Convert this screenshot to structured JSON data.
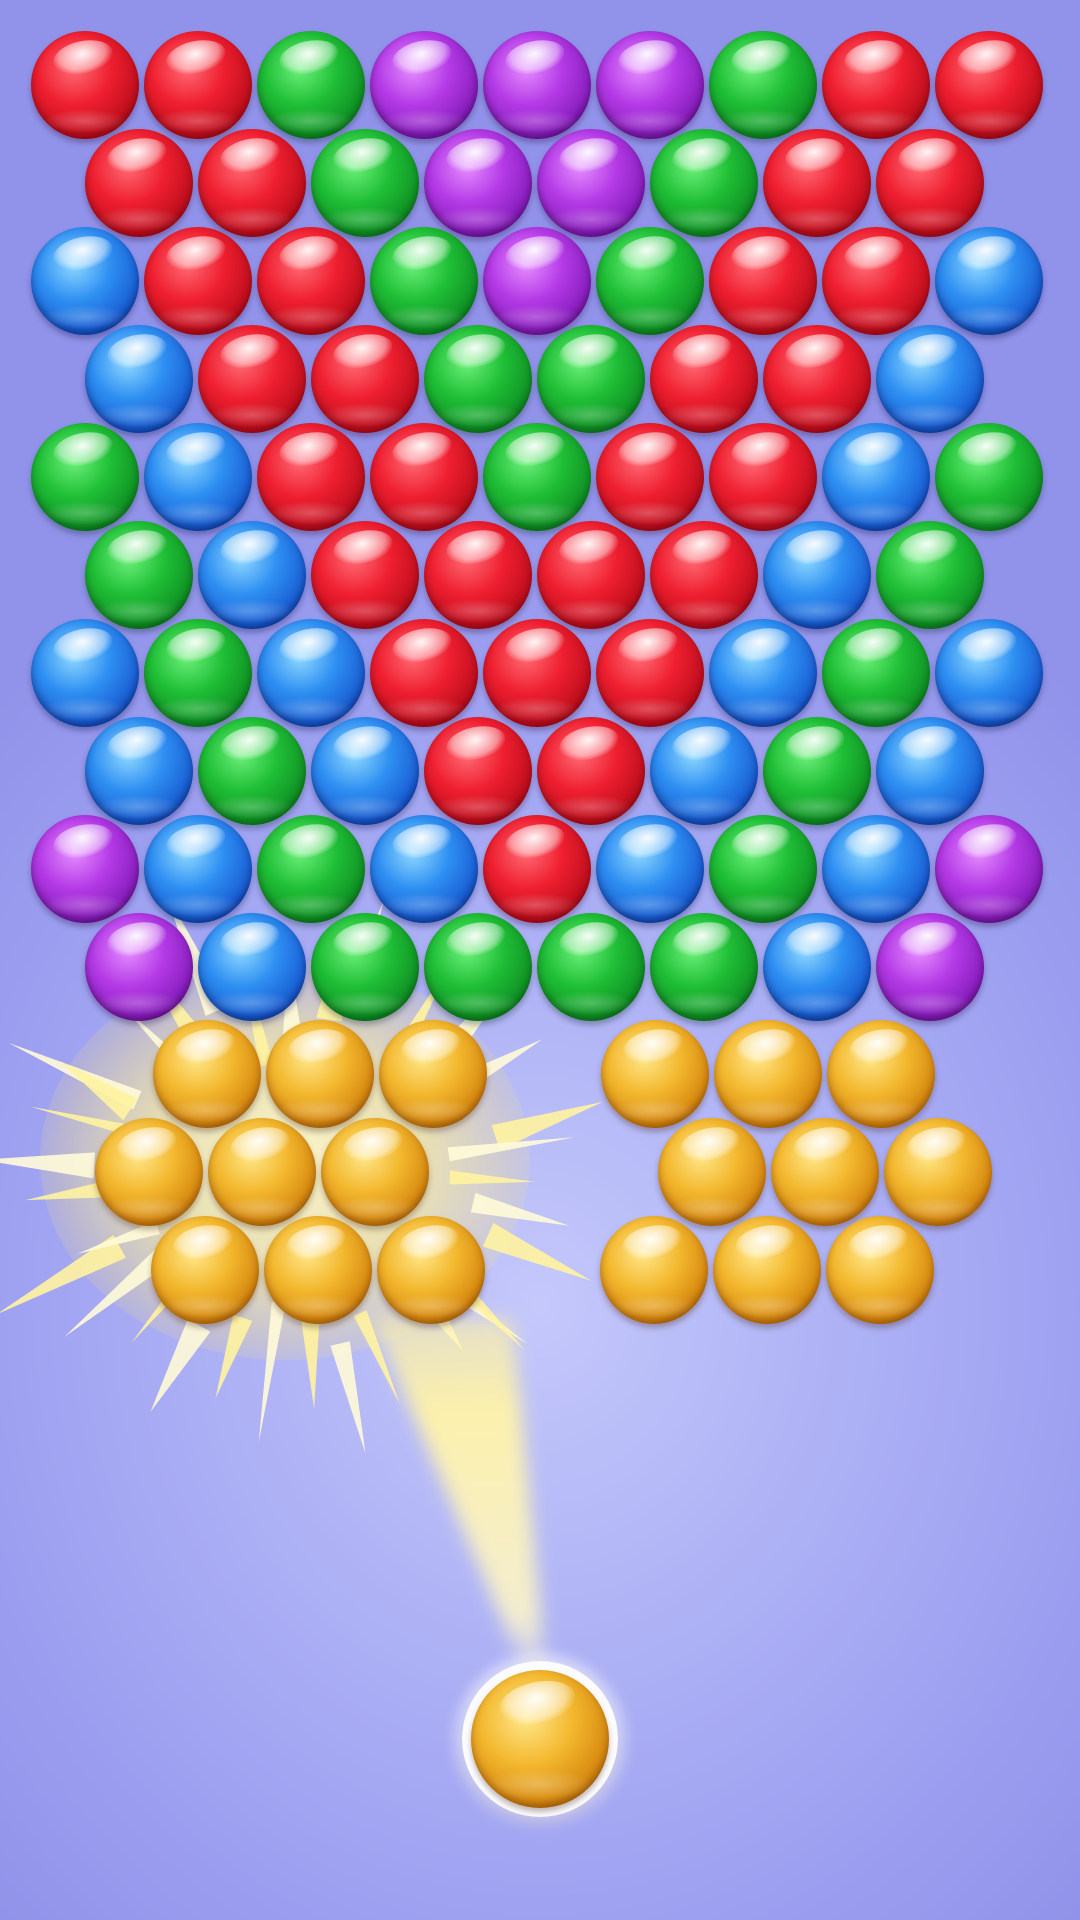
{
  "scene": "bubble-shooter",
  "colors": {
    "background": "#a7aaf3",
    "red": "#e81b2c",
    "green": "#1cb533",
    "purple": "#ac35de",
    "blue": "#2a86ee",
    "gold": "#f0b022"
  },
  "grid": {
    "rows": [
      [
        "red",
        "red",
        "green",
        "purple",
        "purple",
        "purple",
        "green",
        "red",
        "red"
      ],
      [
        "red",
        "red",
        "green",
        "purple",
        "purple",
        "green",
        "red",
        "red"
      ],
      [
        "blue",
        "red",
        "red",
        "green",
        "purple",
        "green",
        "red",
        "red",
        "blue"
      ],
      [
        "blue",
        "red",
        "red",
        "green",
        "green",
        "red",
        "red",
        "blue"
      ],
      [
        "green",
        "blue",
        "red",
        "red",
        "green",
        "red",
        "red",
        "blue",
        "green"
      ],
      [
        "green",
        "blue",
        "red",
        "red",
        "red",
        "red",
        "blue",
        "green"
      ],
      [
        "blue",
        "green",
        "blue",
        "red",
        "red",
        "red",
        "blue",
        "green",
        "blue"
      ],
      [
        "blue",
        "green",
        "blue",
        "red",
        "red",
        "blue",
        "green",
        "blue"
      ],
      [
        "purple",
        "blue",
        "green",
        "blue",
        "red",
        "blue",
        "green",
        "blue",
        "purple"
      ],
      [
        "purple",
        "blue",
        "green",
        "green",
        "green",
        "green",
        "blue",
        "purple"
      ]
    ]
  },
  "gold_clusters": {
    "left_bursting": [
      [
        "gold",
        "gold",
        "gold"
      ],
      [
        "gold",
        "gold",
        "gold"
      ],
      [
        "gold",
        "gold",
        "gold"
      ]
    ],
    "right": [
      [
        "gold",
        "gold",
        "gold"
      ],
      [
        "gold",
        "gold",
        "gold"
      ],
      [
        "gold",
        "gold",
        "gold"
      ]
    ]
  },
  "shooter": {
    "ball_color": "gold",
    "icon": "shooter-ball-icon"
  },
  "effects": {
    "burst": "sparkle-burst-icon",
    "aim": "aim-beam-icon"
  }
}
